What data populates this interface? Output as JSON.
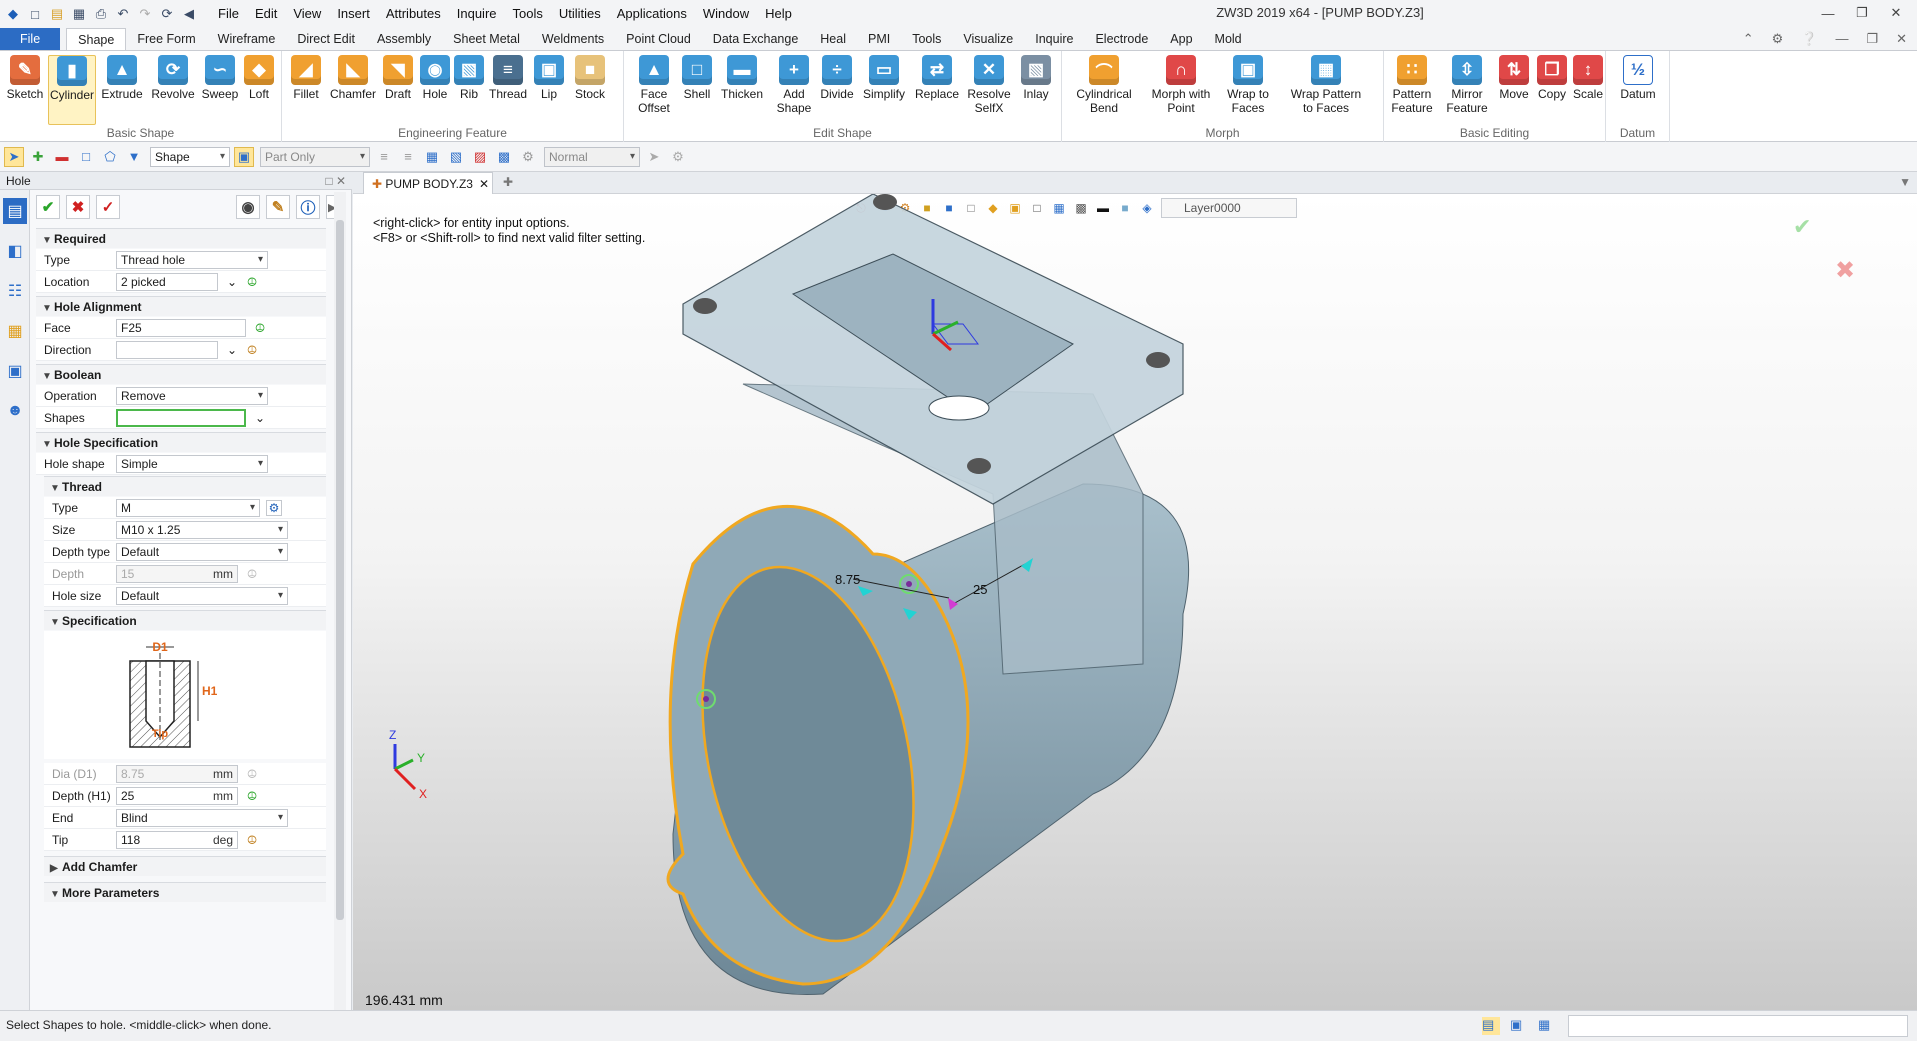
{
  "window": {
    "title": "ZW3D 2019  x64 - [PUMP BODY.Z3]"
  },
  "menu": [
    "File",
    "Edit",
    "View",
    "Insert",
    "Attributes",
    "Inquire",
    "Tools",
    "Utilities",
    "Applications",
    "Window",
    "Help"
  ],
  "ribbon_tabs": [
    "File",
    "Shape",
    "Free Form",
    "Wireframe",
    "Direct Edit",
    "Assembly",
    "Sheet Metal",
    "Weldments",
    "Point Cloud",
    "Data Exchange",
    "Heal",
    "PMI",
    "Tools",
    "Visualize",
    "Inquire",
    "Electrode",
    "App",
    "Mold"
  ],
  "ribbon": {
    "basic_shape": {
      "label": "Basic Shape",
      "buttons": [
        "Sketch",
        "Cylinder",
        "Extrude",
        "Revolve",
        "Sweep",
        "Loft"
      ]
    },
    "engineering": {
      "label": "Engineering Feature",
      "buttons": [
        "Fillet",
        "Chamfer",
        "Draft",
        "Hole",
        "Rib",
        "Thread",
        "Lip",
        "Stock"
      ]
    },
    "edit_shape": {
      "label": "Edit Shape",
      "buttons": [
        "Face\nOffset",
        "Shell",
        "Thicken",
        "Add\nShape",
        "Divide",
        "Simplify",
        "Replace",
        "Resolve\nSelfX",
        "Inlay"
      ]
    },
    "morph": {
      "label": "Morph",
      "buttons": [
        "Cylindrical\nBend",
        "Morph with\nPoint",
        "Wrap to\nFaces",
        "Wrap Pattern\nto Faces"
      ]
    },
    "basic_editing": {
      "label": "Basic Editing",
      "buttons": [
        "Pattern\nFeature",
        "Mirror\nFeature",
        "Move",
        "Copy",
        "Scale"
      ]
    },
    "datum": {
      "label": "Datum",
      "buttons": [
        "Datum"
      ]
    }
  },
  "toolbar2": {
    "filter_value": "Shape",
    "scope_value": "Part Only",
    "render_value": "Normal"
  },
  "panel": {
    "title": "Hole",
    "required": {
      "header": "Required",
      "type_label": "Type",
      "type_value": "Thread hole",
      "location_label": "Location",
      "location_value": "2 picked"
    },
    "alignment": {
      "header": "Hole Alignment",
      "face_label": "Face",
      "face_value": "F25",
      "direction_label": "Direction",
      "direction_value": ""
    },
    "boolean": {
      "header": "Boolean",
      "operation_label": "Operation",
      "operation_value": "Remove",
      "shapes_label": "Shapes",
      "shapes_value": ""
    },
    "spec": {
      "header": "Hole Specification",
      "shape_label": "Hole shape",
      "shape_value": "Simple"
    },
    "thread": {
      "header": "Thread",
      "type_label": "Type",
      "type_value": "M",
      "size_label": "Size",
      "size_value": "M10 x 1.25",
      "depth_type_label": "Depth type",
      "depth_type_value": "Default",
      "depth_label": "Depth",
      "depth_value": "15",
      "depth_unit": "mm",
      "hole_size_label": "Hole size",
      "hole_size_value": "Default"
    },
    "specification": {
      "header": "Specification",
      "diagram_d1": "D1",
      "diagram_h1": "H1",
      "diagram_tip": "Tip",
      "dia_label": "Dia (D1)",
      "dia_value": "8.75",
      "dia_unit": "mm",
      "depth_label": "Depth (H1)",
      "depth_value": "25",
      "depth_unit": "mm",
      "end_label": "End",
      "end_value": "Blind",
      "tip_label": "Tip",
      "tip_value": "118",
      "tip_unit": "deg"
    },
    "add_chamfer": "Add Chamfer",
    "more_params": "More Parameters"
  },
  "document": {
    "tab_label": "PUMP BODY.Z3",
    "hint_line1": "<right-click> for entity input options.",
    "hint_line2": "<F8> or <Shift-roll> to find next valid filter setting.",
    "layer": "Layer0000",
    "scale_readout": "196.431 mm",
    "dim_left": "8.75",
    "dim_right": "25",
    "axis_x": "X",
    "axis_y": "Y",
    "axis_z": "Z"
  },
  "status": {
    "prompt": "Select Shapes to hole. <middle-click> when done."
  },
  "colors": {
    "accent": "#2c6cc4",
    "selection": "#f0a820",
    "part": "#9fb8c6"
  }
}
